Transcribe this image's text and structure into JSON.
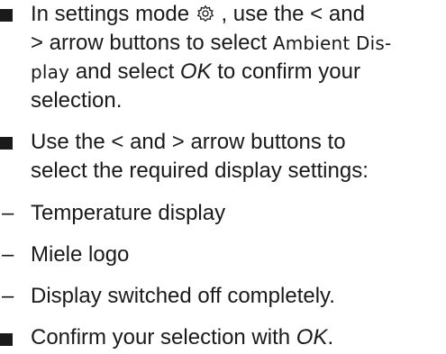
{
  "items": [
    {
      "type": "bullet",
      "lines": [
        {
          "a": "In settings mode",
          "icon": "gear-icon",
          "b": ", use the < and"
        },
        {
          "a": "> arrow buttons to select",
          "display": "Ambient Dis-"
        },
        {
          "display": "play",
          "b": "and select",
          "ok": "OK",
          "c": "to confirm your"
        },
        {
          "a": "selection."
        }
      ]
    },
    {
      "type": "bullet",
      "lines": [
        {
          "a": "Use the < and > arrow buttons to"
        },
        {
          "a": "select the required display settings:"
        }
      ]
    },
    {
      "type": "dash",
      "dash": "–",
      "text": "Temperature display"
    },
    {
      "type": "dash",
      "dash": "–",
      "text": "Miele logo"
    },
    {
      "type": "dash",
      "dash": "–",
      "text": "Display switched off completely."
    },
    {
      "type": "bullet",
      "lines": [
        {
          "a": "Confirm your selection with",
          "ok": "OK",
          "end": "."
        }
      ]
    }
  ]
}
